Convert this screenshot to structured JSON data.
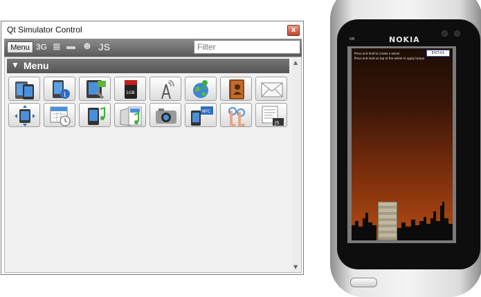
{
  "window": {
    "title": "Qt Simulator Control",
    "close_glyph": "x"
  },
  "toolbar": {
    "menu_label": "Menu",
    "items": [
      "3G",
      "≣",
      "▬",
      "☻",
      "JS"
    ],
    "filter_placeholder": "Filter"
  },
  "section": {
    "label": "Menu",
    "collapse_glyph": "▼"
  },
  "tiles_row1": [
    "devices-icon",
    "phone-info-icon",
    "application-settings-icon",
    "storage-card-icon",
    "network-antenna-icon",
    "location-globe-icon",
    "contacts-icon",
    "messaging-icon"
  ],
  "tiles_row2": [
    "orientation-icon",
    "calendar-icon",
    "audio-phone-icon",
    "media-documents-icon",
    "camera-icon",
    "nfc-icon",
    "multitouch-icon",
    "script-icon"
  ],
  "tile_labels": {
    "storage": "1GB",
    "nfc": "NFC",
    "script": "JS"
  },
  "phone": {
    "brand": "NOKIA",
    "status_text": "NB",
    "game": {
      "instructions": [
        "Press and hold to create a wheel.",
        "Press and hold on top of the wheel to apply torque"
      ],
      "exit_label": "EXIT-01"
    }
  }
}
